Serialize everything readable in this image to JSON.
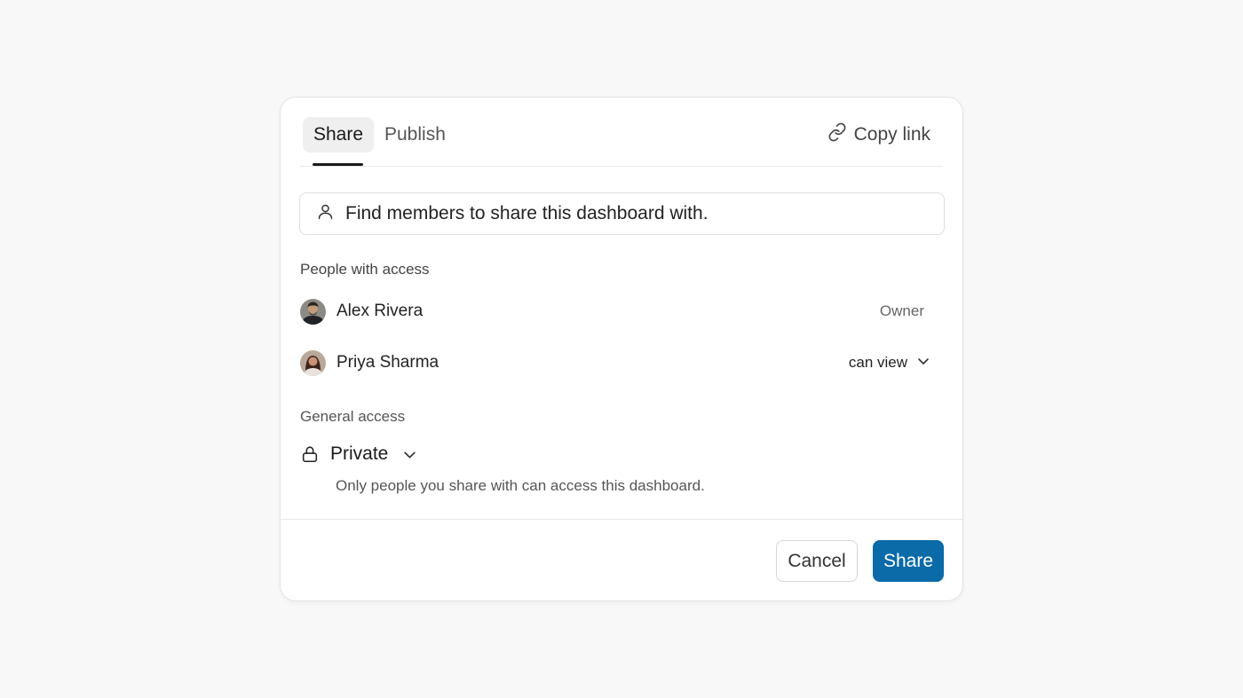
{
  "tabs": {
    "share": "Share",
    "publish": "Publish",
    "copy_link": "Copy link"
  },
  "search": {
    "placeholder": "Find members to share this dashboard with."
  },
  "people": {
    "label": "People with access",
    "members": [
      {
        "name": "Alex Rivera",
        "role": "Owner"
      },
      {
        "name": "Priya Sharma",
        "role": "can view"
      }
    ]
  },
  "general": {
    "label": "General access",
    "value": "Private",
    "description": "Only people you share with can access this dashboard."
  },
  "footer": {
    "cancel": "Cancel",
    "share": "Share"
  },
  "colors": {
    "primary": "#0b6aa8",
    "background": "#f8f8f9"
  },
  "icons": {
    "copy_link": "link-icon",
    "search": "user-icon",
    "general": "lock-icon",
    "dropdown": "chevron-down-icon"
  }
}
